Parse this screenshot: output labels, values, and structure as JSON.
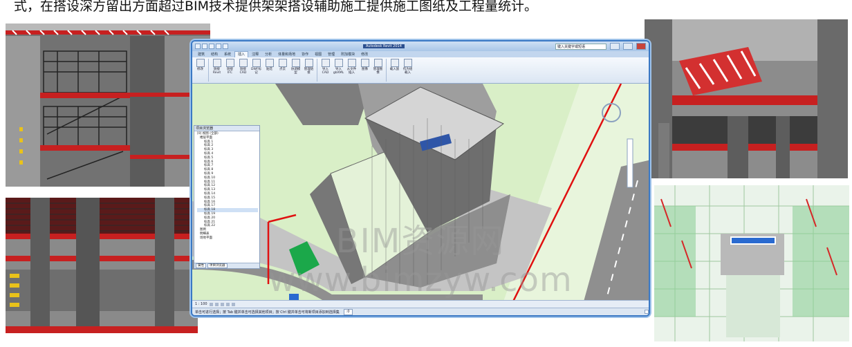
{
  "caption": "式，在搭设深方留出方面超过BIM技术提供架架搭设辅助施工提供施工图纸及工程量统计。",
  "revit": {
    "doc_title": "Autodesk Revit 2014",
    "search_placeholder": "键入关键字或短语",
    "tabs": [
      "建筑",
      "结构",
      "系统",
      "插入",
      "注释",
      "分析",
      "体量和场地",
      "协作",
      "视图",
      "管理",
      "附加模块",
      "修改"
    ],
    "active_tab": "插入",
    "ribbon_buttons": [
      "修改",
      "链接Revit",
      "链接IFC",
      "链接CAD",
      "DWF标记",
      "贴花",
      "点云",
      "协调模型",
      "管理链接",
      "导入CAD",
      "导入gbXML",
      "从文件插入",
      "图像",
      "管理图像",
      "载入族",
      "作为组载入"
    ],
    "browser": {
      "title": "项目浏览器",
      "root": "[0] 视图 (全部)",
      "group": "楼层平面",
      "levels": [
        "标高 1",
        "标高 2",
        "标高 3",
        "标高 4",
        "标高 5",
        "标高 6",
        "标高 7",
        "标高 8",
        "标高 9",
        "标高 10",
        "标高 11",
        "标高 12",
        "标高 13",
        "标高 14",
        "标高 15",
        "标高 16",
        "标高 17",
        "标高 18",
        "标高 19",
        "标高 20",
        "标高 21",
        "标高 22"
      ],
      "other": [
        "图例",
        "明细表",
        "场地平面"
      ],
      "footer_tabs": [
        "属性",
        "项目浏览器"
      ]
    },
    "viewbar": "1 : 100",
    "status": "单击可进行选择；按 Tab 键并单击可选择其他项目；按 Ctrl 键并单击可将新项目添加到选择集",
    "status_field": ":0"
  },
  "watermark": {
    "line1": "BIM资源网",
    "line2": "www.bimzyw.com"
  },
  "colors": {
    "accent": "#3a78c4",
    "site": "#d9efc7",
    "road": "#8f8f8f",
    "boundary": "#e01010"
  }
}
